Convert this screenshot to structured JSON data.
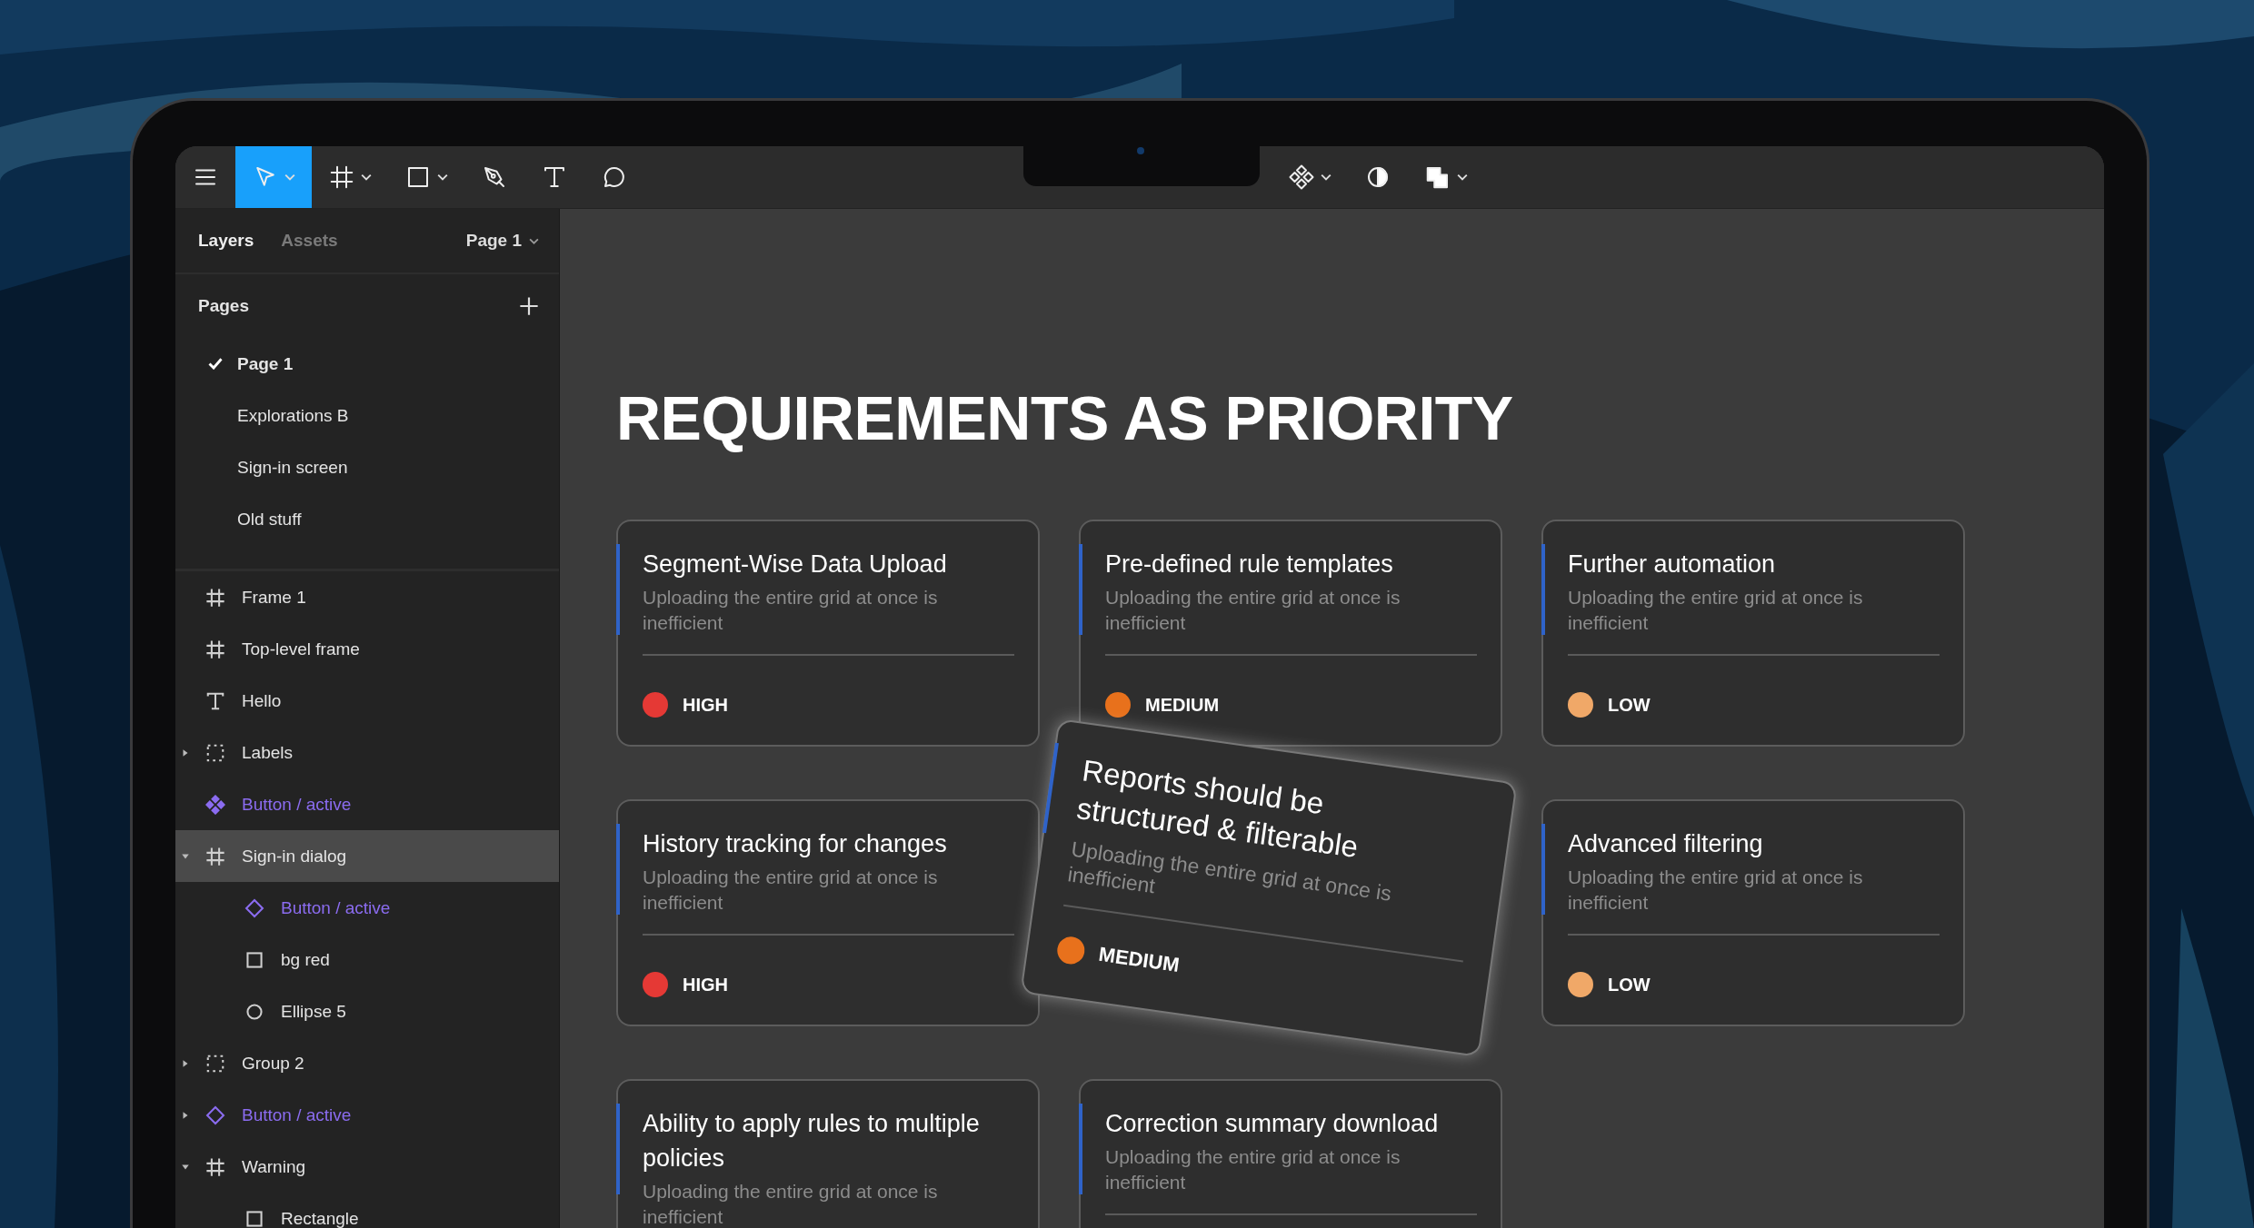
{
  "toolbar": {
    "tools": [
      {
        "kind": "menu",
        "selected": false,
        "dropdown": false
      },
      {
        "kind": "move",
        "selected": true,
        "dropdown": true
      },
      {
        "kind": "frame",
        "selected": false,
        "dropdown": true
      },
      {
        "kind": "shape",
        "selected": false,
        "dropdown": true
      },
      {
        "kind": "pen",
        "selected": false,
        "dropdown": false
      },
      {
        "kind": "text",
        "selected": false,
        "dropdown": false
      },
      {
        "kind": "comment",
        "selected": false,
        "dropdown": false
      }
    ],
    "right_tools": [
      {
        "kind": "component",
        "selected": false,
        "dropdown": true
      },
      {
        "kind": "contrast",
        "selected": false,
        "dropdown": false
      },
      {
        "kind": "boolean",
        "selected": false,
        "dropdown": true
      }
    ]
  },
  "sidebar": {
    "tabs": [
      {
        "label": "Layers",
        "selected": true
      },
      {
        "label": "Assets",
        "selected": false
      }
    ],
    "page_menu": "Page 1",
    "pages_title": "Pages",
    "pages": [
      {
        "label": "Page 1",
        "selected": true
      },
      {
        "label": "Explorations B",
        "selected": false
      },
      {
        "label": "Sign-in screen",
        "selected": false
      },
      {
        "label": "Old stuff",
        "selected": false
      }
    ],
    "layers": [
      {
        "kind": "frame",
        "label": "Frame 1",
        "selected": false
      },
      {
        "kind": "frame",
        "label": "Top-level frame",
        "selected": false
      },
      {
        "kind": "text",
        "label": "Hello",
        "selected": false
      },
      {
        "kind": "group",
        "label": "Labels",
        "selected": false,
        "expanded": false
      },
      {
        "kind": "component",
        "label": "Button / active",
        "selected": false
      },
      {
        "kind": "frame",
        "label": "Sign-in dialog",
        "selected": true,
        "expanded": true,
        "children": [
          {
            "kind": "instance",
            "label": "Button / active",
            "selected": false
          },
          {
            "kind": "rect",
            "label": "bg red",
            "selected": false
          },
          {
            "kind": "ellipse",
            "label": "Ellipse 5",
            "selected": false
          }
        ]
      },
      {
        "kind": "group",
        "label": "Group 2",
        "selected": false,
        "expanded": false
      },
      {
        "kind": "instance",
        "label": "Button / active",
        "selected": false,
        "expanded": false
      },
      {
        "kind": "frame",
        "label": "Warning",
        "selected": false,
        "expanded": true,
        "children": [
          {
            "kind": "rect",
            "label": "Rectangle",
            "selected": false
          }
        ]
      }
    ]
  },
  "canvas": {
    "title": "REQUIREMENTS AS PRIORITY",
    "cards": [
      {
        "kind": "card",
        "title": "Segment-Wise Data Upload",
        "description": "Uploading the entire grid at once is inefficient",
        "priority": "HIGH",
        "color": "#e53935"
      },
      {
        "kind": "card",
        "title": "Pre-defined rule templates",
        "description": "Uploading the entire grid at once is inefficient",
        "priority": "MEDIUM",
        "color": "#e8711c"
      },
      {
        "kind": "card",
        "title": "Further automation",
        "description": "Uploading the entire grid at once is inefficient",
        "priority": "LOW",
        "color": "#f0a868"
      },
      {
        "kind": "card",
        "title": "History tracking for changes",
        "description": "Uploading the entire grid at once is inefficient",
        "priority": "HIGH",
        "color": "#e53935"
      },
      {
        "kind": "dragged",
        "title": "Reports should be structured & filterable",
        "description": "Uploading the entire grid at once is inefficient",
        "priority": "MEDIUM",
        "color": "#e8711c"
      },
      {
        "kind": "card",
        "title": "Advanced filtering",
        "description": "Uploading the entire grid at once is inefficient",
        "priority": "LOW",
        "color": "#f0a868"
      },
      {
        "kind": "card",
        "title": "Ability to apply rules to multiple policies",
        "description": "Uploading the entire grid at once is inefficient"
      },
      {
        "kind": "card",
        "title": "Correction summary download",
        "description": "Uploading the entire grid at once is inefficient"
      }
    ]
  }
}
